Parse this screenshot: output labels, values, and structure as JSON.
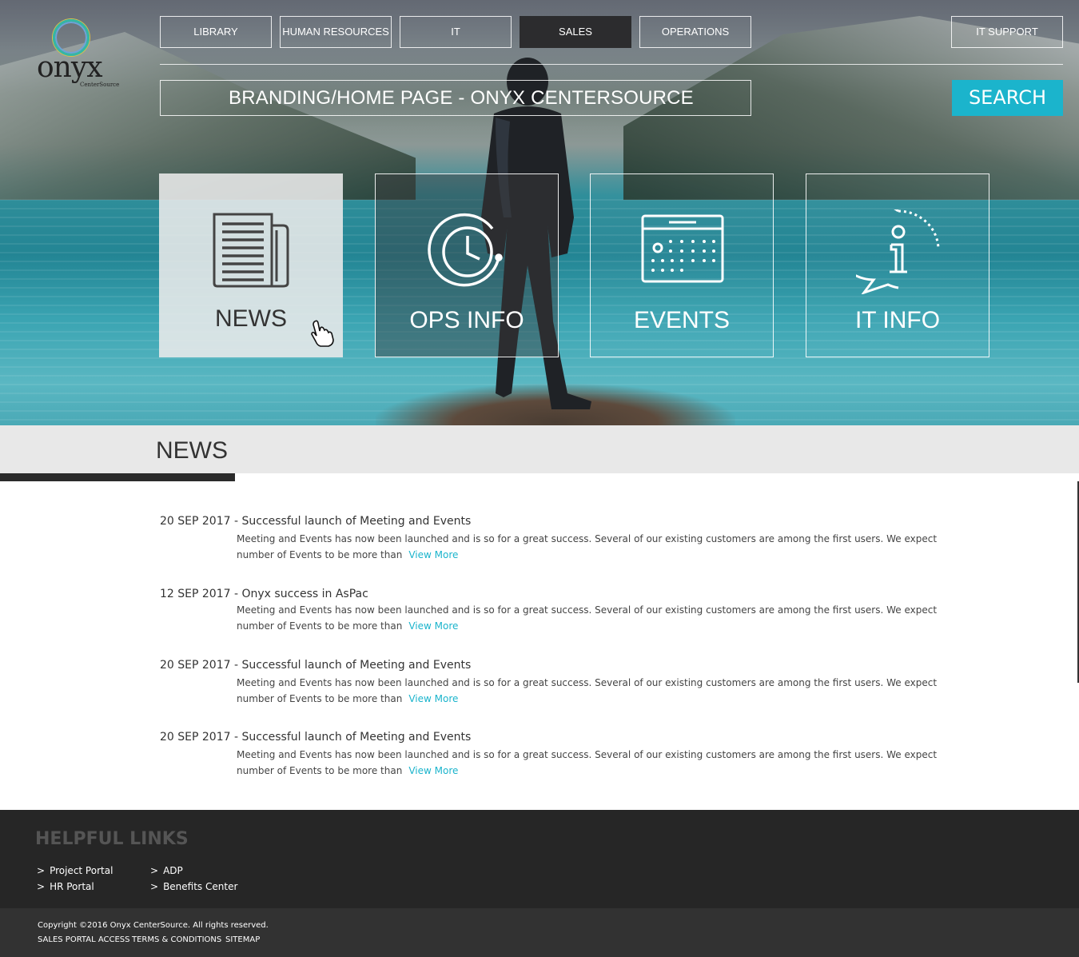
{
  "brand": {
    "name": "onyx",
    "sub": "CenterSource"
  },
  "nav": {
    "items": [
      {
        "label": "LIBRARY"
      },
      {
        "label": "HUMAN RESOURCES"
      },
      {
        "label": "IT"
      },
      {
        "label": "SALES",
        "active": true
      },
      {
        "label": "OPERATIONS"
      }
    ],
    "support": "IT SUPPORT"
  },
  "search": {
    "value": "BRANDING/HOME PAGE - ONYX CENTERSOURCE",
    "button": "SEARCH"
  },
  "tiles": [
    {
      "label": "NEWS",
      "icon": "newspaper-icon"
    },
    {
      "label": "OPS INFO",
      "icon": "clock-icon"
    },
    {
      "label": "EVENTS",
      "icon": "calendar-icon"
    },
    {
      "label": "IT INFO",
      "icon": "info-bubble-icon"
    }
  ],
  "news": {
    "title": "NEWS",
    "items": [
      {
        "date": "20 SEP 2017",
        "headline": " - Successful  launch of Meeting and Events",
        "body": "Meeting and Events has now been launched and is so for a great success. Several of our existing customers are among the first users. We expect number of Events to be more than",
        "more": "View More"
      },
      {
        "date": "12 SEP 2017",
        "headline": " - Onyx success in AsPac",
        "body": "Meeting and Events has now been launched and is so for a great success. Several of our existing customers are among the first users. We expect number of Events to be more than",
        "more": "View More"
      },
      {
        "date": "20 SEP 2017",
        "headline": " - Successful  launch of Meeting and Events",
        "body": "Meeting and Events has now been launched and is so for a great success. Several of our existing customers are among the first users. We expect number of Events to be more than",
        "more": "View More"
      },
      {
        "date": "20 SEP 2017",
        "headline": " - Successful  launch of Meeting and Events",
        "body": "Meeting and Events has now been launched and is so for a great success. Several of our existing customers are among the first users. We expect number of Events to be more than",
        "more": "View More"
      }
    ]
  },
  "footer": {
    "title": "HELPFUL LINKS",
    "links": [
      "Project Portal",
      "HR Portal",
      "ADP",
      "Benefits Center"
    ],
    "chevron": ">",
    "copyright": "Copyright ©2016 Onyx CenterSource. All rights reserved.",
    "sublinks": [
      "SALES PORTAL ACCESS",
      "TERMS & CONDITIONS",
      "SITEMAP"
    ]
  },
  "colors": {
    "accent": "#1bb4cc",
    "dark": "#262626",
    "activeNav": "#2c2c2e"
  }
}
